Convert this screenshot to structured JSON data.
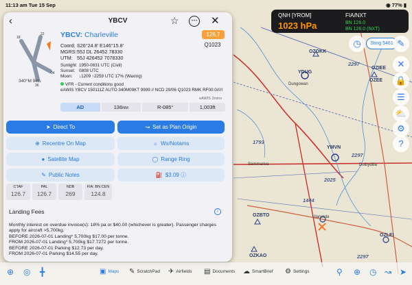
{
  "status_bar": {
    "time": "11:13 am",
    "date": "Tue 15 Sep",
    "battery": "77%"
  },
  "qnh": {
    "label": "QNH [YROM]",
    "value": "1023 hPa"
  },
  "fia": {
    "label": "FIA/NXT",
    "line1": "BN 126.0",
    "line2": "BN 126.0 (NXT)"
  },
  "sting_chip": "Sting 5461",
  "map": {
    "labels": [
      "OZOKK",
      "YDUG",
      "OZIEE",
      "OZEE",
      "YMVN",
      "OZBTO",
      "OZKAO",
      "OZLEI"
    ],
    "towns": [
      "Dungowan",
      "Ularunda",
      "Dulbydilla",
      "Sommariva"
    ],
    "nums": [
      "2297",
      "2297",
      "1793",
      "1444",
      "2025",
      "2297"
    ]
  },
  "panel": {
    "title": "YBCV",
    "airport_code": "YBCV:",
    "airport_city": "Charleville",
    "frequency": "126.7",
    "qnh": "Q1023",
    "coords": [
      {
        "k": "Coord:",
        "v": "S26°24.8' E146°15.8'"
      },
      {
        "k": "MGRS:",
        "v": "55J DL 26452 78330"
      },
      {
        "k": "UTM:",
        "v": "55J 426452 7078330"
      }
    ],
    "sun": [
      {
        "k": "Sunlight:",
        "v": "1950-0831 UTC (Civil)"
      },
      {
        "k": "Sunset:",
        "v": "0808 UTC"
      },
      {
        "k": "Moon:",
        "v": "↓1209 ↑2259 UTC 17% (Waxing)"
      }
    ],
    "wind": "340°M 9kts",
    "metar_status": "VFR - Current conditions good",
    "metar_text": "eAWIS YBCV 150111Z AUTO 340M09KT 9999 // NCD 29/06 Q1023 RMK RF00.0/////",
    "metar_age": "eAWIS 2mins",
    "runway": {
      "ad": "AD",
      "length": "136",
      "length_unit": "NM",
      "direction": "R-085°",
      "elevation": "1,003ft"
    },
    "actions": {
      "direct_to": "Direct To",
      "plan_origin": "Set as Plan Origin",
      "recentre": "Recentre On Map",
      "wx_notams": "Wx/Notams",
      "satellite": "Satellite Map",
      "range_ring": "Range Ring",
      "public_notes": "Public Notes",
      "fuel_price": "$3.09"
    },
    "tiles": [
      {
        "lbl": "CTAF",
        "val": "126.7"
      },
      {
        "lbl": "PAL",
        "val": "126.7"
      },
      {
        "lbl": "NDB",
        "val": "269"
      },
      {
        "lbl": "FIA: BN CEN",
        "val": "124.8"
      }
    ],
    "fees_title": "Landing Fees",
    "fees": [
      "Monthly interest on overdue invoice(s): 18% pa or $40.00 (whichever is greater). Passenger charges apply for aircraft >5,700kg.",
      "BEFORE 2026-07-01 Landing* 5,700kg $17.00 per tonne.",
      "FROM 2026-07-01 Landing* 5,700kg $17.7272 per tonne.",
      "BEFORE 2026-07-01 Parking $12.73 per day.",
      "FROM 2026-07-01 Parking $14.55 per day."
    ]
  },
  "tabs": [
    "Maps",
    "ScratchPad",
    "Airfields",
    "Documents",
    "SmartBrief",
    "Settings"
  ]
}
